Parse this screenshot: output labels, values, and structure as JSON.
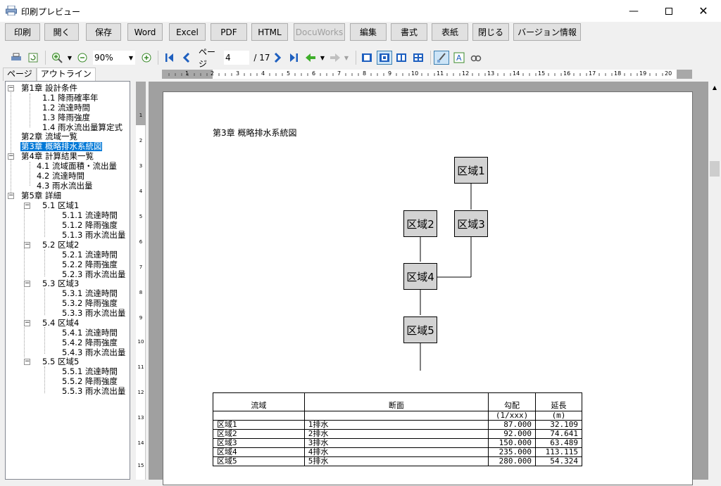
{
  "window": {
    "title": "印刷プレビュー"
  },
  "toolbar": {
    "print": "印刷",
    "open": "開く",
    "save": "保存",
    "word": "Word",
    "excel": "Excel",
    "pdf": "PDF",
    "html": "HTML",
    "docuworks": "DocuWorks",
    "edit": "編集",
    "format": "書式",
    "paper": "表紙",
    "close": "閉じる",
    "version": "バージョン情報"
  },
  "toolbar2": {
    "zoom": "90%",
    "page_label": "ページ",
    "page_value": "4",
    "page_total": "/ 17"
  },
  "tabs": {
    "page": "ページ",
    "outline": "アウトライン"
  },
  "tree": {
    "ch1": "第1章 設計条件",
    "s11": "1.1 降雨確率年",
    "s12": "1.2 流達時間",
    "s13": "1.3 降雨強度",
    "s14": "1.4 雨水流出量算定式",
    "ch2": "第2章 流域一覧",
    "ch3": "第3章 概略排水系統図",
    "ch4": "第4章 計算結果一覧",
    "s41": "4.1 流域面積・流出量",
    "s42": "4.2 流達時間",
    "s43": "4.3 雨水流出量",
    "ch5": "第5章 詳細",
    "s51": "5.1 区域1",
    "s511": "5.1.1 流達時間",
    "s512": "5.1.2 降雨強度",
    "s513": "5.1.3 雨水流出量",
    "s52": "5.2 区域2",
    "s521": "5.2.1 流達時間",
    "s522": "5.2.2 降雨強度",
    "s523": "5.2.3 雨水流出量",
    "s53": "5.3 区域3",
    "s531": "5.3.1 流達時間",
    "s532": "5.3.2 降雨強度",
    "s533": "5.3.3 雨水流出量",
    "s54": "5.4 区域4",
    "s541": "5.4.1 流達時間",
    "s542": "5.4.2 降雨強度",
    "s543": "5.4.3 雨水流出量",
    "s55": "5.5 区域5",
    "s551": "5.5.1 流達時間",
    "s552": "5.5.2 降雨強度",
    "s553": "5.5.3 雨水流出量"
  },
  "page": {
    "title": "第3章 概略排水系統図",
    "nodes": {
      "n1": "区域1",
      "n2": "区域2",
      "n3": "区域3",
      "n4": "区域4",
      "n5": "区域5"
    },
    "table": {
      "headers": {
        "basin": "流域",
        "section": "断面",
        "slope": "勾配",
        "slope_unit": "(1/xxx)",
        "length": "延長",
        "length_unit": "(m)"
      },
      "rows": [
        {
          "basin": "区域1",
          "section": "1排水",
          "slope": "87.000",
          "length": "32.109"
        },
        {
          "basin": "区域2",
          "section": "2排水",
          "slope": "92.000",
          "length": "74.641"
        },
        {
          "basin": "区域3",
          "section": "3排水",
          "slope": "150.000",
          "length": "63.489"
        },
        {
          "basin": "区域4",
          "section": "4排水",
          "slope": "235.000",
          "length": "113.115"
        },
        {
          "basin": "区域5",
          "section": "5排水",
          "slope": "280.000",
          "length": "54.324"
        }
      ]
    }
  },
  "colors": {
    "selection": "#0078d7",
    "nav_blue": "#1e5fbf",
    "node_fill": "#d3d3d3"
  }
}
